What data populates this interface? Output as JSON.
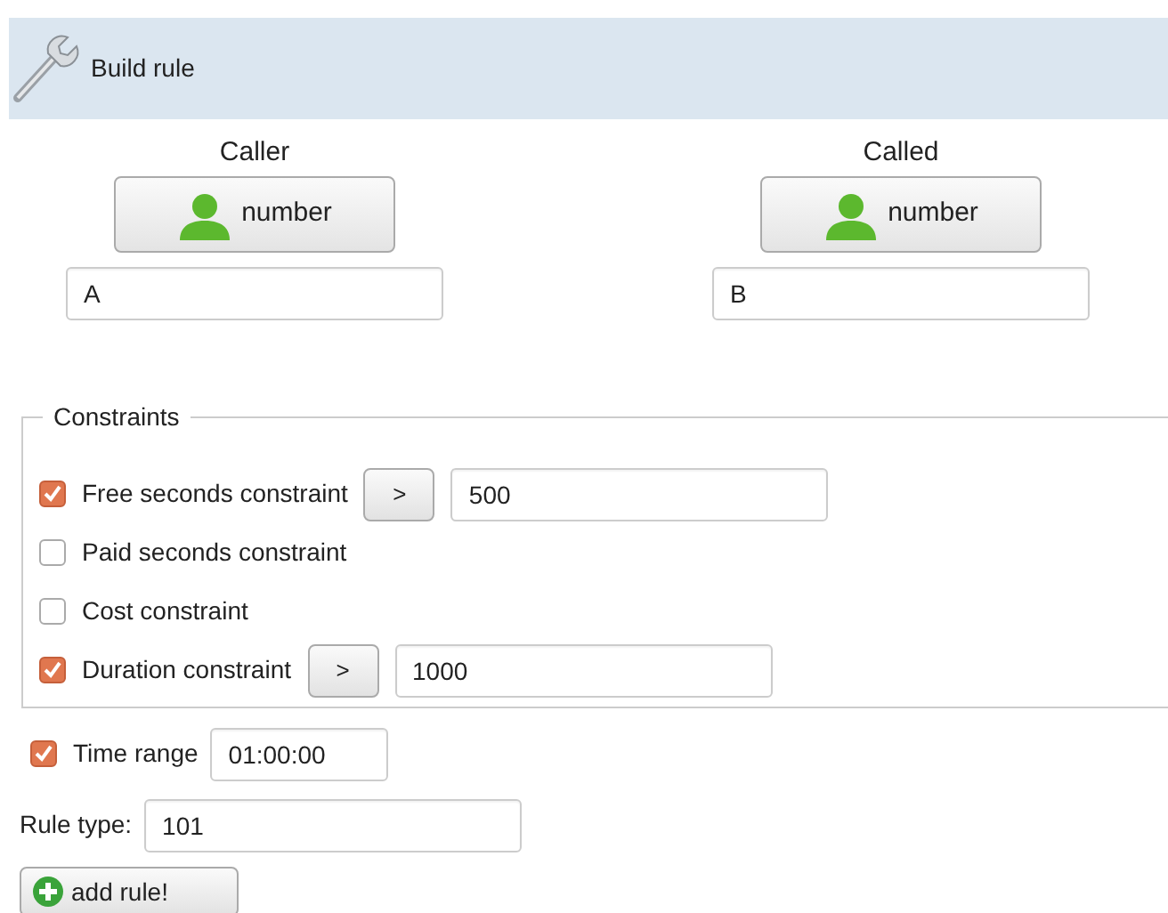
{
  "header": {
    "title": "Build rule"
  },
  "parties": [
    {
      "label": "Caller",
      "button": "number",
      "value": "A"
    },
    {
      "label": "Called",
      "button": "number",
      "value": "B"
    }
  ],
  "constraints": {
    "legend": "Constraints",
    "rows": [
      {
        "label": "Free seconds constraint",
        "checked": true,
        "operator": ">",
        "value": "500"
      },
      {
        "label": "Paid seconds constraint",
        "checked": false
      },
      {
        "label": "Cost constraint",
        "checked": false
      },
      {
        "label": "Duration constraint",
        "checked": true,
        "operator": ">",
        "value": "1000"
      }
    ]
  },
  "time_range": {
    "label": "Time range",
    "checked": true,
    "value": "01:00:00"
  },
  "rule_type": {
    "label": "Rule type:",
    "value": "101"
  },
  "add_button": {
    "label": "add rule!"
  }
}
